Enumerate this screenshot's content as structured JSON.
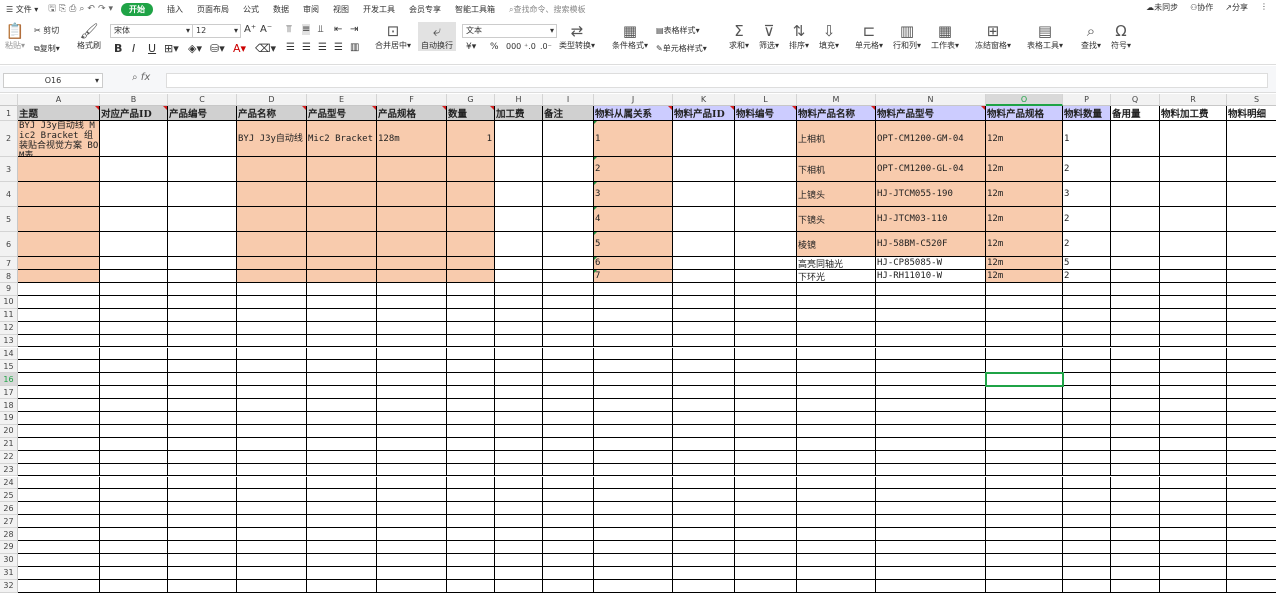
{
  "menubar": {
    "file": "文件",
    "tabs": [
      "开始",
      "插入",
      "页面布局",
      "公式",
      "数据",
      "审阅",
      "视图",
      "开发工具",
      "会员专享",
      "智能工具箱"
    ],
    "active_tab": "开始",
    "search_placeholder": "查找命令、搜索模板",
    "sync": "未同步",
    "collab": "协作",
    "share": "分享"
  },
  "toolbar": {
    "paste": "粘贴",
    "cut": "剪切",
    "copy": "复制",
    "format_painter": "格式刷",
    "font_name": "宋体",
    "font_size": "12",
    "number_format": "文本",
    "merge_center": "合并居中",
    "auto_wrap": "自动换行",
    "type_convert": "类型转换",
    "conditional_format": "条件格式",
    "table_style": "表格样式",
    "cell_style": "单元格样式",
    "sum": "求和",
    "filter": "筛选",
    "sort": "排序",
    "fill": "填充",
    "cell": "单元格",
    "row_col": "行和列",
    "worksheet": "工作表",
    "freeze": "冻结窗格",
    "table_tools": "表格工具",
    "find": "查找",
    "symbol": "符号"
  },
  "formula_bar": {
    "name_box": "O16",
    "fx": "fx",
    "value": ""
  },
  "columns": [
    "A",
    "B",
    "C",
    "D",
    "E",
    "F",
    "G",
    "H",
    "I",
    "J",
    "K",
    "L",
    "M",
    "N",
    "O",
    "P",
    "Q",
    "R",
    "S"
  ],
  "selected_column": "O",
  "selected_row": "16",
  "row_numbers": [
    "1",
    "2",
    "3",
    "4",
    "5",
    "6",
    "7",
    "8",
    "9",
    "10",
    "11",
    "12",
    "13",
    "14",
    "15",
    "16",
    "17",
    "18",
    "19",
    "20",
    "21",
    "22",
    "23",
    "24",
    "25",
    "26",
    "27",
    "28",
    "29",
    "30",
    "31",
    "32"
  ],
  "headers": [
    "主题",
    "对应产品ID",
    "产品编号",
    "产品名称",
    "产品型号",
    "产品规格",
    "数量",
    "加工费",
    "备注",
    "物料从属关系",
    "物料产品ID",
    "物料编号",
    "物料产品名称",
    "物料产品型号",
    "物料产品规格",
    "物料数量",
    "备用量",
    "物料加工费",
    "物料明细"
  ],
  "product": {
    "topic": "BYJ J3y自动线 Mic2 Bracket 组装贴合视觉方案 BOM表",
    "name": "BYJ J3y自动线",
    "model": "Mic2 Bracket",
    "spec": "128m",
    "qty": "1"
  },
  "materials": [
    {
      "rel": "1",
      "name": "上相机",
      "model": "OPT-CM1200-GM-04",
      "spec": "12m",
      "qty": "1"
    },
    {
      "rel": "2",
      "name": "下相机",
      "model": "OPT-CM1200-GL-04",
      "spec": "12m",
      "qty": "2"
    },
    {
      "rel": "3",
      "name": "上镜头",
      "model": "HJ-JTCM055-190",
      "spec": "12m",
      "qty": "3"
    },
    {
      "rel": "4",
      "name": "下镜头",
      "model": "HJ-JTCM03-110",
      "spec": "12m",
      "qty": "2"
    },
    {
      "rel": "5",
      "name": "棱镜",
      "model": "HJ-58BM-C520F",
      "spec": "12m",
      "qty": "2"
    },
    {
      "rel": "6",
      "name": "高亮同轴光",
      "model": "HJ-CP85085-W",
      "spec": "12m",
      "qty": "5"
    },
    {
      "rel": "7",
      "name": "下环光",
      "model": "HJ-RH11010-W",
      "spec": "12m",
      "qty": "2"
    }
  ],
  "colors": {
    "peach": "#f8cbad",
    "lavender": "#ccccff",
    "header_gray": "#d0d0d0",
    "accent": "#1fa346",
    "comment": "#d62020"
  }
}
